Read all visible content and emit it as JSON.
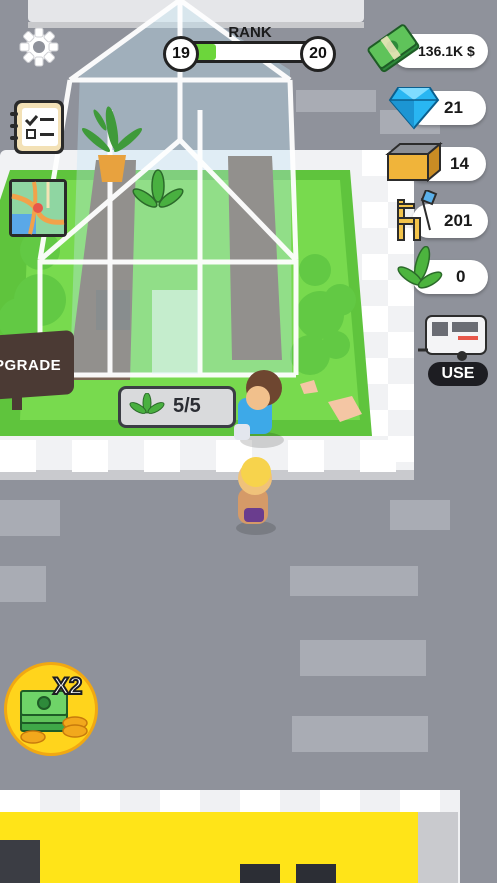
{
  "hud": {
    "rank_label": "RANK",
    "rank_current": "19",
    "rank_next": "20",
    "rank_progress": 0.25,
    "settings_icon": "gear-icon",
    "tasks_icon": "clipboard-checklist-icon",
    "map_icon": "map-icon"
  },
  "resources": {
    "money": "136.1K $",
    "gems": "21",
    "bricks": "14",
    "furniture": "201",
    "plants": "0"
  },
  "vehicle": {
    "icon": "camper-trailer-icon",
    "use_label": "USE"
  },
  "greenhouse": {
    "plant_icon": "plant-leaf-icon",
    "capacity_text": "5/5"
  },
  "upgrade_sign": {
    "label": "PGRADE"
  },
  "booster": {
    "label": "X2",
    "icon": "cash-stack-icon"
  },
  "colors": {
    "grass": "#6fd14a",
    "road": "#8f929b",
    "money_green": "#3fa848",
    "gem_blue": "#2eb4f0",
    "booster_yellow": "#ffd41c",
    "building_yellow": "#ffe418"
  }
}
